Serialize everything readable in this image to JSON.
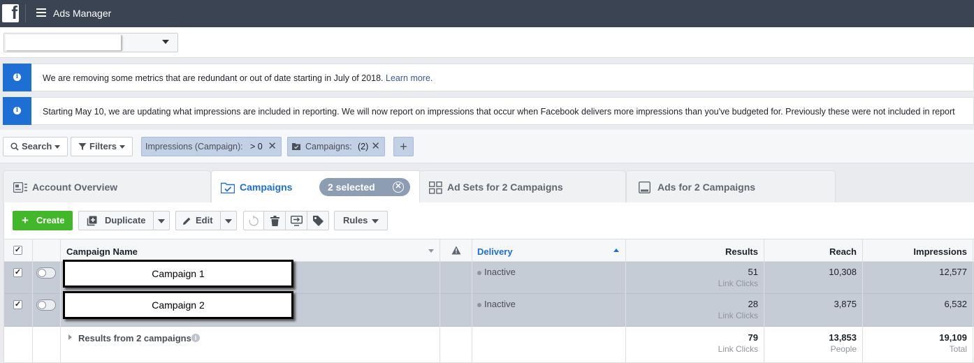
{
  "topbar": {
    "app_title": "Ads Manager",
    "logo": "facebook-logo",
    "menu_icon": "hamburger-icon"
  },
  "account_select": {
    "value": ""
  },
  "notices": [
    {
      "text": "We are removing some metrics that are redundant or out of date starting in July of 2018. ",
      "link": "Learn more."
    },
    {
      "text": "Starting May 10, we are updating what impressions are included in reporting. We will now report on impressions that occur when Facebook delivers more impressions than you've budgeted for. Previously these were not included in report",
      "link": ""
    }
  ],
  "filterbar": {
    "search_label": "Search",
    "filters_label": "Filters",
    "chips": [
      {
        "label": "Impressions (Campaign):",
        "op": "> 0"
      },
      {
        "label": "Campaigns:",
        "op": "(2)"
      }
    ],
    "add_label": "+"
  },
  "tabs": {
    "account_overview": "Account Overview",
    "campaigns": "Campaigns",
    "selected": "2 selected",
    "ad_sets": "Ad Sets for 2 Campaigns",
    "ads": "Ads for 2 Campaigns"
  },
  "toolbar": {
    "create": "Create",
    "duplicate": "Duplicate",
    "edit": "Edit",
    "rules": "Rules"
  },
  "table": {
    "headers": {
      "name": "Campaign Name",
      "delivery": "Delivery",
      "results": "Results",
      "reach": "Reach",
      "impressions": "Impressions"
    },
    "rows": [
      {
        "name": "Campaign 1",
        "delivery": "Inactive",
        "results": "51",
        "results_sub": "Link Clicks",
        "reach": "10,308",
        "impressions": "12,577"
      },
      {
        "name": "Campaign 2",
        "delivery": "Inactive",
        "results": "28",
        "results_sub": "Link Clicks",
        "reach": "3,875",
        "impressions": "6,532"
      }
    ],
    "summary": {
      "label": "Results from 2 campaigns",
      "results": "79",
      "results_sub": "Link Clicks",
      "reach": "13,853",
      "reach_sub": "People",
      "impressions": "19,109",
      "impressions_sub": "Total"
    }
  },
  "colors": {
    "topbar": "#3b4453",
    "accent_blue": "#1d6fd6",
    "create_green": "#42b72a",
    "selected_row": "#c5ccd6"
  }
}
